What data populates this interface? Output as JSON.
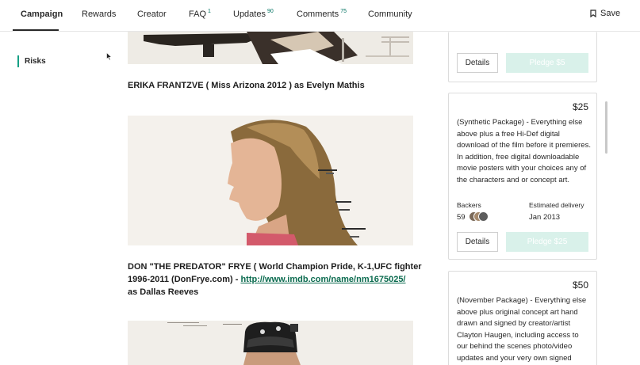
{
  "nav": {
    "tabs": [
      {
        "label": "Campaign",
        "count": ""
      },
      {
        "label": "Rewards",
        "count": ""
      },
      {
        "label": "Creator",
        "count": ""
      },
      {
        "label": "FAQ",
        "count": "1"
      },
      {
        "label": "Updates",
        "count": "90"
      },
      {
        "label": "Comments",
        "count": "75"
      },
      {
        "label": "Community",
        "count": ""
      }
    ],
    "save_label": "Save"
  },
  "sidebar": {
    "items": [
      {
        "label": "Risks"
      }
    ]
  },
  "story": {
    "caption1": "ERIKA FRANTZVE ( Miss Arizona 2012 ) as Evelyn Mathis",
    "caption2_line1": "DON \"THE PREDATOR\" FRYE ( World Champion Pride, K-1,UFC fighter",
    "caption2_line2_text": "1996-2011 (DonFrye.com) - ",
    "caption2_link": "http://www.imdb.com/name/nm1675025/",
    "caption2_line3": "as Dallas Reeves"
  },
  "rewards": [
    {
      "details_label": "Details",
      "pledge_label": "Pledge $5"
    },
    {
      "price": "$25",
      "description": "(Synthetic Package) - Everything else above plus a free Hi-Def digital download of the film before it premieres.  In addition, free digital downloadable movie posters with your choices any of the characters and or concept art.",
      "backers_label": "Backers",
      "backers_count": "59",
      "delivery_label": "Estimated delivery",
      "delivery_value": "Jan 2013",
      "details_label": "Details",
      "pledge_label": "Pledge $25"
    },
    {
      "price": "$50",
      "description": "(November Package) - Everything else above plus  original concept art hand drawn and signed by creator/artist Clayton Haugen, including access to our behind the scenes photo/video updates and your very own signed shooting script (for"
    }
  ],
  "colors": {
    "accent": "#037362",
    "pledge_bg": "#d9f1ea",
    "risk_bar": "#16a085"
  }
}
